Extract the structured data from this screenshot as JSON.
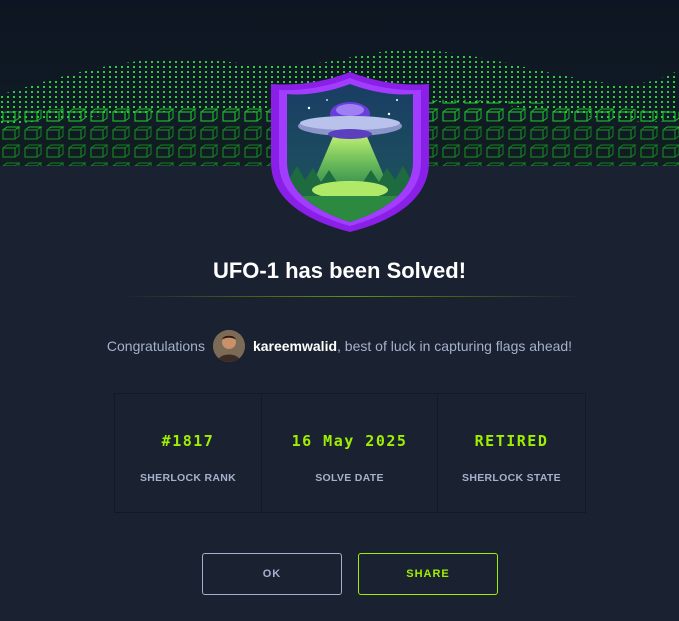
{
  "modal": {
    "title": "UFO-1 has been Solved!",
    "congrats_prefix": "Congratulations",
    "username": "kareemwalid",
    "congrats_suffix": ", best of luck in capturing flags ahead!"
  },
  "stats": [
    {
      "value": "#1817",
      "label": "SHERLOCK RANK"
    },
    {
      "value": "16 May 2025",
      "label": "SOLVE DATE"
    },
    {
      "value": "RETIRED",
      "label": "SHERLOCK STATE"
    }
  ],
  "buttons": {
    "ok_label": "OK",
    "share_label": "SHARE"
  },
  "colors": {
    "background": "#1a2130",
    "accent_green": "#9fef00",
    "badge_purple": "#9c27ff",
    "muted_text": "#a4b1cd"
  },
  "icons": {
    "badge": "ufo-badge-icon",
    "avatar": "user-avatar"
  }
}
